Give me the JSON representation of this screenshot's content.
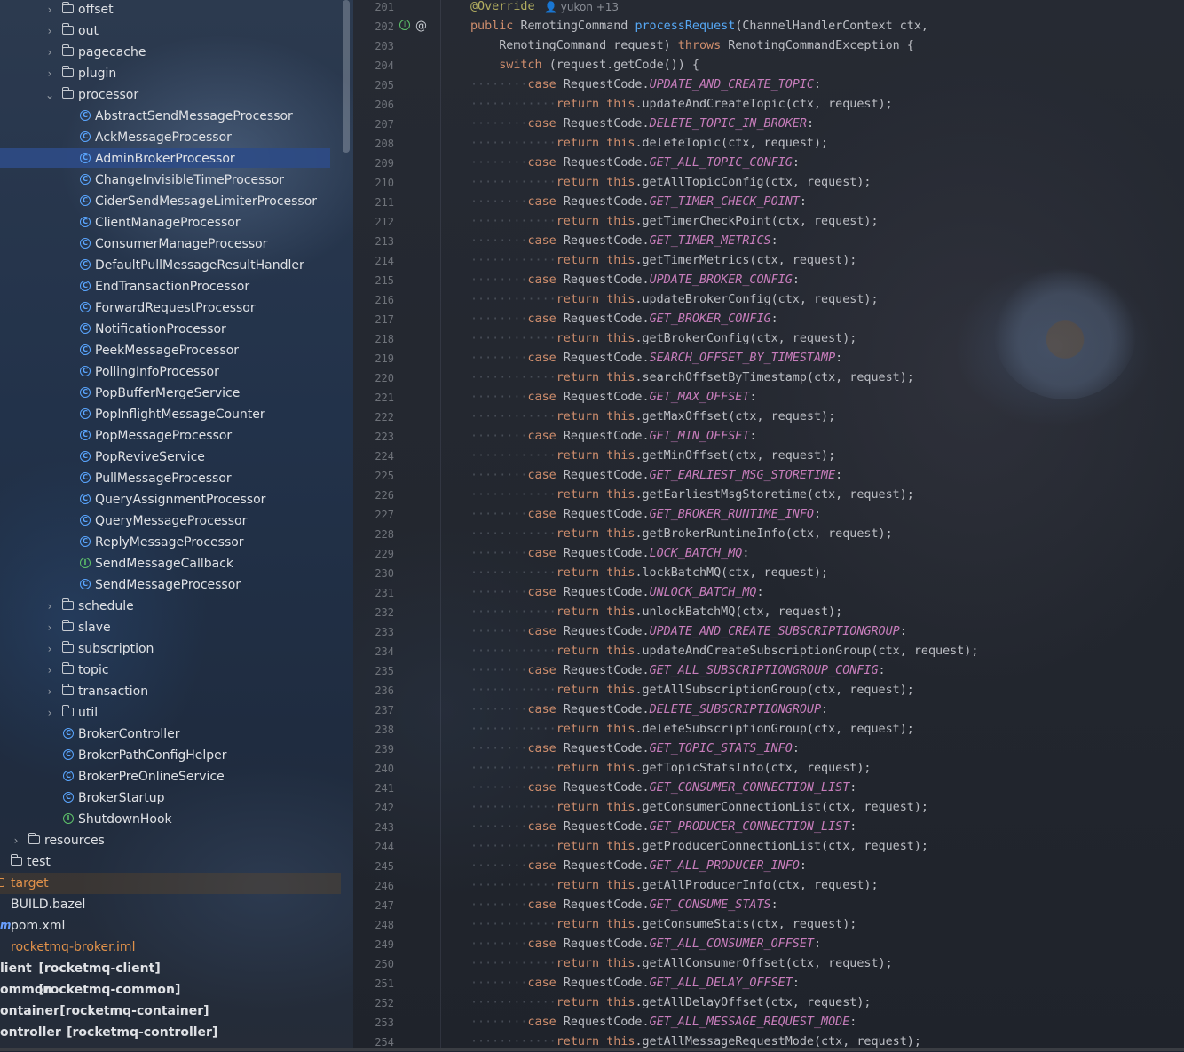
{
  "project_tree": {
    "items": [
      {
        "label": "offset",
        "kind": "folder",
        "indent": 1,
        "expandable": true,
        "expanded": false
      },
      {
        "label": "out",
        "kind": "folder",
        "indent": 1,
        "expandable": true,
        "expanded": false
      },
      {
        "label": "pagecache",
        "kind": "folder",
        "indent": 1,
        "expandable": true,
        "expanded": false
      },
      {
        "label": "plugin",
        "kind": "folder",
        "indent": 1,
        "expandable": true,
        "expanded": false
      },
      {
        "label": "processor",
        "kind": "folder",
        "indent": 1,
        "expandable": true,
        "expanded": true
      },
      {
        "label": "AbstractSendMessageProcessor",
        "kind": "class",
        "indent": 2
      },
      {
        "label": "AckMessageProcessor",
        "kind": "class",
        "indent": 2
      },
      {
        "label": "AdminBrokerProcessor",
        "kind": "class",
        "indent": 2,
        "selected": true
      },
      {
        "label": "ChangeInvisibleTimeProcessor",
        "kind": "class",
        "indent": 2
      },
      {
        "label": "CiderSendMessageLimiterProcessor",
        "kind": "class",
        "indent": 2
      },
      {
        "label": "ClientManageProcessor",
        "kind": "class",
        "indent": 2
      },
      {
        "label": "ConsumerManageProcessor",
        "kind": "class",
        "indent": 2
      },
      {
        "label": "DefaultPullMessageResultHandler",
        "kind": "class",
        "indent": 2
      },
      {
        "label": "EndTransactionProcessor",
        "kind": "class",
        "indent": 2
      },
      {
        "label": "ForwardRequestProcessor",
        "kind": "class",
        "indent": 2
      },
      {
        "label": "NotificationProcessor",
        "kind": "class",
        "indent": 2
      },
      {
        "label": "PeekMessageProcessor",
        "kind": "class",
        "indent": 2
      },
      {
        "label": "PollingInfoProcessor",
        "kind": "class",
        "indent": 2
      },
      {
        "label": "PopBufferMergeService",
        "kind": "class",
        "indent": 2
      },
      {
        "label": "PopInflightMessageCounter",
        "kind": "class",
        "indent": 2
      },
      {
        "label": "PopMessageProcessor",
        "kind": "class",
        "indent": 2
      },
      {
        "label": "PopReviveService",
        "kind": "class",
        "indent": 2
      },
      {
        "label": "PullMessageProcessor",
        "kind": "class",
        "indent": 2
      },
      {
        "label": "QueryAssignmentProcessor",
        "kind": "class",
        "indent": 2
      },
      {
        "label": "QueryMessageProcessor",
        "kind": "class",
        "indent": 2
      },
      {
        "label": "ReplyMessageProcessor",
        "kind": "class",
        "indent": 2
      },
      {
        "label": "SendMessageCallback",
        "kind": "interface",
        "indent": 2
      },
      {
        "label": "SendMessageProcessor",
        "kind": "class",
        "indent": 2
      },
      {
        "label": "schedule",
        "kind": "folder",
        "indent": 1,
        "expandable": true,
        "expanded": false
      },
      {
        "label": "slave",
        "kind": "folder",
        "indent": 1,
        "expandable": true,
        "expanded": false
      },
      {
        "label": "subscription",
        "kind": "folder",
        "indent": 1,
        "expandable": true,
        "expanded": false
      },
      {
        "label": "topic",
        "kind": "folder",
        "indent": 1,
        "expandable": true,
        "expanded": false
      },
      {
        "label": "transaction",
        "kind": "folder",
        "indent": 1,
        "expandable": true,
        "expanded": false
      },
      {
        "label": "util",
        "kind": "folder",
        "indent": 1,
        "expandable": true,
        "expanded": false
      },
      {
        "label": "BrokerController",
        "kind": "class",
        "indent": 1
      },
      {
        "label": "BrokerPathConfigHelper",
        "kind": "class",
        "indent": 1
      },
      {
        "label": "BrokerPreOnlineService",
        "kind": "class",
        "indent": 1
      },
      {
        "label": "BrokerStartup",
        "kind": "class-main",
        "indent": 1
      },
      {
        "label": "ShutdownHook",
        "kind": "interface",
        "indent": 1
      },
      {
        "label": "resources",
        "kind": "folder",
        "indent": 0,
        "expandable": true,
        "expanded": false
      },
      {
        "label": "test",
        "kind": "folder",
        "indent": -1,
        "expandable": true,
        "expanded": false
      },
      {
        "label": "target",
        "kind": "folder-excluded",
        "indent": -2,
        "style": "orange"
      },
      {
        "label": "BUILD.bazel",
        "kind": "file",
        "indent": -2
      },
      {
        "label": "pom.xml",
        "kind": "maven",
        "indent": -2
      },
      {
        "label": "rocketmq-broker.iml",
        "kind": "file",
        "indent": -2,
        "style": "orange"
      },
      {
        "label": "lient",
        "suffix": "[rocketmq-client]",
        "kind": "module",
        "indent": -3
      },
      {
        "label": "ommon",
        "suffix": "[rocketmq-common]",
        "kind": "module",
        "indent": -3
      },
      {
        "label": "ontainer",
        "suffix": "[rocketmq-container]",
        "kind": "module",
        "indent": -3
      },
      {
        "label": "ontroller",
        "suffix": "[rocketmq-controller]",
        "kind": "module",
        "indent": -3
      }
    ]
  },
  "editor": {
    "author_hint": "yukon +13",
    "lines": [
      {
        "n": 201,
        "tokens": [
          [
            "anno",
            "@Override"
          ]
        ],
        "hint": true
      },
      {
        "n": 202,
        "tokens": [
          [
            "kw",
            "public "
          ],
          [
            "plain",
            "RemotingCommand "
          ],
          [
            "fn",
            "processRequest"
          ],
          [
            "plain",
            "(ChannelHandlerContext ctx,"
          ]
        ],
        "icons": true
      },
      {
        "n": 203,
        "tokens": [
          [
            "plain",
            "    RemotingCommand request) "
          ],
          [
            "kw",
            "throws "
          ],
          [
            "plain",
            "RemotingCommandException {"
          ]
        ]
      },
      {
        "n": 204,
        "tokens": [
          [
            "plain",
            "    "
          ],
          [
            "kw",
            "switch "
          ],
          [
            "plain",
            "(request.getCode()) {"
          ]
        ]
      },
      {
        "n": 205,
        "case": "UPDATE_AND_CREATE_TOPIC"
      },
      {
        "n": 206,
        "ret": "updateAndCreateTopic(ctx, request);"
      },
      {
        "n": 207,
        "case": "DELETE_TOPIC_IN_BROKER"
      },
      {
        "n": 208,
        "ret": "deleteTopic(ctx, request);"
      },
      {
        "n": 209,
        "case": "GET_ALL_TOPIC_CONFIG"
      },
      {
        "n": 210,
        "ret": "getAllTopicConfig(ctx, request);"
      },
      {
        "n": 211,
        "case": "GET_TIMER_CHECK_POINT"
      },
      {
        "n": 212,
        "ret": "getTimerCheckPoint(ctx, request);"
      },
      {
        "n": 213,
        "case": "GET_TIMER_METRICS"
      },
      {
        "n": 214,
        "ret": "getTimerMetrics(ctx, request);"
      },
      {
        "n": 215,
        "case": "UPDATE_BROKER_CONFIG"
      },
      {
        "n": 216,
        "ret": "updateBrokerConfig(ctx, request);"
      },
      {
        "n": 217,
        "case": "GET_BROKER_CONFIG"
      },
      {
        "n": 218,
        "ret": "getBrokerConfig(ctx, request);"
      },
      {
        "n": 219,
        "case": "SEARCH_OFFSET_BY_TIMESTAMP"
      },
      {
        "n": 220,
        "ret": "searchOffsetByTimestamp(ctx, request);"
      },
      {
        "n": 221,
        "case": "GET_MAX_OFFSET"
      },
      {
        "n": 222,
        "ret": "getMaxOffset(ctx, request);"
      },
      {
        "n": 223,
        "case": "GET_MIN_OFFSET"
      },
      {
        "n": 224,
        "ret": "getMinOffset(ctx, request);"
      },
      {
        "n": 225,
        "case": "GET_EARLIEST_MSG_STORETIME"
      },
      {
        "n": 226,
        "ret": "getEarliestMsgStoretime(ctx, request);"
      },
      {
        "n": 227,
        "case": "GET_BROKER_RUNTIME_INFO"
      },
      {
        "n": 228,
        "ret": "getBrokerRuntimeInfo(ctx, request);"
      },
      {
        "n": 229,
        "case": "LOCK_BATCH_MQ"
      },
      {
        "n": 230,
        "ret": "lockBatchMQ(ctx, request);"
      },
      {
        "n": 231,
        "case": "UNLOCK_BATCH_MQ"
      },
      {
        "n": 232,
        "ret": "unlockBatchMQ(ctx, request);"
      },
      {
        "n": 233,
        "case": "UPDATE_AND_CREATE_SUBSCRIPTIONGROUP"
      },
      {
        "n": 234,
        "ret": "updateAndCreateSubscriptionGroup(ctx, request);"
      },
      {
        "n": 235,
        "case": "GET_ALL_SUBSCRIPTIONGROUP_CONFIG"
      },
      {
        "n": 236,
        "ret": "getAllSubscriptionGroup(ctx, request);"
      },
      {
        "n": 237,
        "case": "DELETE_SUBSCRIPTIONGROUP"
      },
      {
        "n": 238,
        "ret": "deleteSubscriptionGroup(ctx, request);"
      },
      {
        "n": 239,
        "case": "GET_TOPIC_STATS_INFO"
      },
      {
        "n": 240,
        "ret": "getTopicStatsInfo(ctx, request);"
      },
      {
        "n": 241,
        "case": "GET_CONSUMER_CONNECTION_LIST"
      },
      {
        "n": 242,
        "ret": "getConsumerConnectionList(ctx, request);"
      },
      {
        "n": 243,
        "case": "GET_PRODUCER_CONNECTION_LIST"
      },
      {
        "n": 244,
        "ret": "getProducerConnectionList(ctx, request);"
      },
      {
        "n": 245,
        "case": "GET_ALL_PRODUCER_INFO"
      },
      {
        "n": 246,
        "ret": "getAllProducerInfo(ctx, request);"
      },
      {
        "n": 247,
        "case": "GET_CONSUME_STATS"
      },
      {
        "n": 248,
        "ret": "getConsumeStats(ctx, request);"
      },
      {
        "n": 249,
        "case": "GET_ALL_CONSUMER_OFFSET"
      },
      {
        "n": 250,
        "ret": "getAllConsumerOffset(ctx, request);"
      },
      {
        "n": 251,
        "case": "GET_ALL_DELAY_OFFSET"
      },
      {
        "n": 252,
        "ret": "getAllDelayOffset(ctx, request);"
      },
      {
        "n": 253,
        "case": "GET_ALL_MESSAGE_REQUEST_MODE"
      },
      {
        "n": 254,
        "ret": "getAllMessageRequestMode(ctx, request);"
      }
    ]
  },
  "strings": {
    "case_kw": "case ",
    "request_code": "RequestCode.",
    "return_kw": "return ",
    "this_kw": "this",
    "colon": ":"
  },
  "colors": {
    "keyword": "#cf8e6d",
    "annotation": "#b3ae60",
    "method": "#56a8f5",
    "constant": "#c77dbb",
    "selection": "#2e4b86",
    "class_icon": "#5aa6ff",
    "interface_icon": "#5ec26a"
  }
}
